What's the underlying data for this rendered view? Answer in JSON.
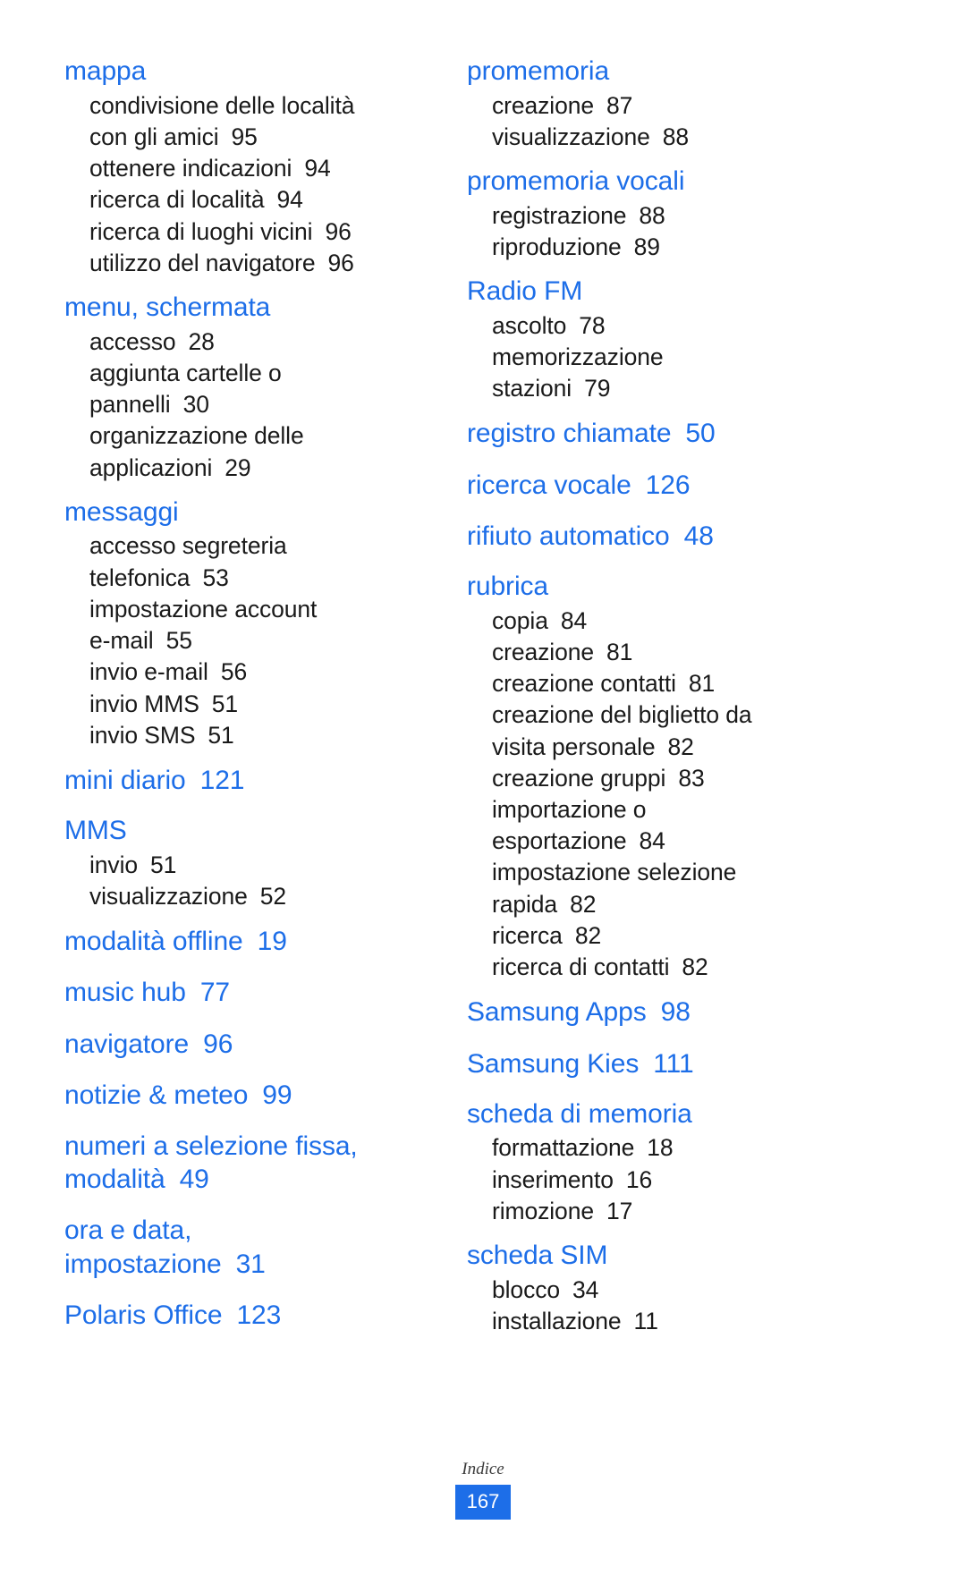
{
  "document": {
    "type": "index-page",
    "language": "it",
    "accent_color": "#1d6ee8",
    "body_color": "#1a1a1a",
    "background_color": "#ffffff"
  },
  "footer": {
    "label": "Indice",
    "page_number": "167"
  },
  "columns": [
    {
      "id": "left",
      "entries": [
        {
          "heading": "mappa",
          "page": "",
          "subs": [
            {
              "text": "condivisione delle località\ncon gli amici",
              "page": "95"
            },
            {
              "text": "ottenere indicazioni",
              "page": "94"
            },
            {
              "text": "ricerca di località",
              "page": "94"
            },
            {
              "text": "ricerca di luoghi vicini",
              "page": "96"
            },
            {
              "text": "utilizzo del navigatore",
              "page": "96"
            }
          ]
        },
        {
          "heading": "menu, schermata",
          "page": "",
          "subs": [
            {
              "text": "accesso",
              "page": "28"
            },
            {
              "text": "aggiunta cartelle o\npannelli",
              "page": "30"
            },
            {
              "text": "organizzazione delle\napplicazioni",
              "page": "29"
            }
          ]
        },
        {
          "heading": "messaggi",
          "page": "",
          "subs": [
            {
              "text": "accesso segreteria\ntelefonica",
              "page": "53"
            },
            {
              "text": "impostazione account\ne-mail",
              "page": "55"
            },
            {
              "text": "invio e-mail",
              "page": "56"
            },
            {
              "text": "invio MMS",
              "page": "51"
            },
            {
              "text": "invio SMS",
              "page": "51"
            }
          ]
        },
        {
          "heading": "mini diario",
          "page": "121",
          "subs": []
        },
        {
          "heading": "MMS",
          "page": "",
          "subs": [
            {
              "text": "invio",
              "page": "51"
            },
            {
              "text": "visualizzazione",
              "page": "52"
            }
          ]
        },
        {
          "heading": "modalità offline",
          "page": "19",
          "subs": []
        },
        {
          "heading": "music hub",
          "page": "77",
          "subs": []
        },
        {
          "heading": "navigatore",
          "page": "96",
          "subs": []
        },
        {
          "heading": "notizie & meteo",
          "page": "99",
          "subs": []
        },
        {
          "heading": "numeri a selezione fissa,\nmodalità",
          "page": "49",
          "subs": []
        },
        {
          "heading": "ora e data,\nimpostazione",
          "page": "31",
          "subs": []
        },
        {
          "heading": "Polaris Office",
          "page": "123",
          "subs": []
        }
      ]
    },
    {
      "id": "right",
      "entries": [
        {
          "heading": "promemoria",
          "page": "",
          "subs": [
            {
              "text": "creazione",
              "page": "87"
            },
            {
              "text": "visualizzazione",
              "page": "88"
            }
          ]
        },
        {
          "heading": "promemoria vocali",
          "page": "",
          "subs": [
            {
              "text": "registrazione",
              "page": "88"
            },
            {
              "text": "riproduzione",
              "page": "89"
            }
          ]
        },
        {
          "heading": "Radio FM",
          "page": "",
          "subs": [
            {
              "text": "ascolto",
              "page": "78"
            },
            {
              "text": "memorizzazione\nstazioni",
              "page": "79"
            }
          ]
        },
        {
          "heading": "registro chiamate",
          "page": "50",
          "subs": []
        },
        {
          "heading": "ricerca vocale",
          "page": "126",
          "subs": []
        },
        {
          "heading": "rifiuto automatico",
          "page": "48",
          "subs": []
        },
        {
          "heading": "rubrica",
          "page": "",
          "subs": [
            {
              "text": "copia",
              "page": "84"
            },
            {
              "text": "creazione",
              "page": "81"
            },
            {
              "text": "creazione contatti",
              "page": "81"
            },
            {
              "text": "creazione del biglietto da\nvisita personale",
              "page": "82"
            },
            {
              "text": "creazione gruppi",
              "page": "83"
            },
            {
              "text": "importazione o\nesportazione",
              "page": "84"
            },
            {
              "text": "impostazione selezione\nrapida",
              "page": "82"
            },
            {
              "text": "ricerca",
              "page": "82"
            },
            {
              "text": "ricerca di contatti",
              "page": "82"
            }
          ]
        },
        {
          "heading": "Samsung Apps",
          "page": "98",
          "subs": []
        },
        {
          "heading": "Samsung Kies",
          "page": "111",
          "subs": []
        },
        {
          "heading": "scheda di memoria",
          "page": "",
          "subs": [
            {
              "text": "formattazione",
              "page": "18"
            },
            {
              "text": "inserimento",
              "page": "16"
            },
            {
              "text": "rimozione",
              "page": "17"
            }
          ]
        },
        {
          "heading": "scheda SIM",
          "page": "",
          "subs": [
            {
              "text": "blocco",
              "page": "34"
            },
            {
              "text": "installazione",
              "page": "11"
            }
          ]
        }
      ]
    }
  ]
}
